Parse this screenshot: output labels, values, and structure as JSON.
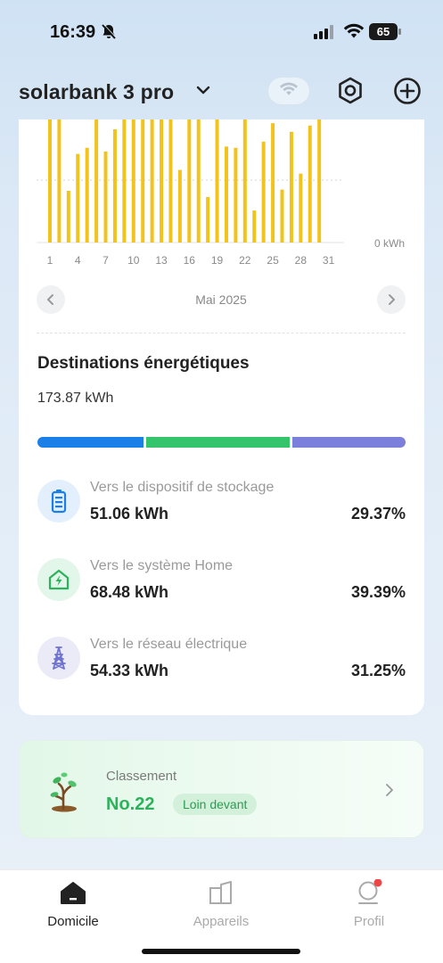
{
  "status": {
    "time": "16:39",
    "battery": "65"
  },
  "header": {
    "device_name": "solarbank 3 pro"
  },
  "chart_data": {
    "type": "bar",
    "x": [
      1,
      2,
      3,
      4,
      5,
      6,
      7,
      8,
      9,
      10,
      11,
      12,
      13,
      14,
      15,
      16,
      17,
      18,
      19,
      20,
      21,
      22,
      23,
      24,
      25,
      26,
      27,
      28,
      29,
      30,
      31
    ],
    "values": [
      10,
      10,
      4.2,
      7.2,
      7.7,
      10,
      7.4,
      9.2,
      10,
      10,
      10,
      10,
      10,
      10,
      5.9,
      10,
      10,
      3.7,
      10,
      7.8,
      7.7,
      10,
      2.6,
      8.2,
      9.7,
      4.3,
      9.0,
      5.6,
      9.5,
      10,
      null
    ],
    "xtick_labels": [
      "1",
      "4",
      "7",
      "10",
      "13",
      "16",
      "19",
      "22",
      "25",
      "28",
      "31"
    ],
    "y_zero_label": "0 kWh",
    "color": "#f2c31c"
  },
  "month_nav": {
    "label": "Mai 2025"
  },
  "destinations": {
    "title": "Destinations énergétiques",
    "total": "173.87 kWh",
    "colors": {
      "storage": "#1a7fe8",
      "home": "#33c46c",
      "grid": "#7b7fdb"
    },
    "items": [
      {
        "label": "Vers le dispositif de stockage",
        "value": "51.06 kWh",
        "percent": "29.37%"
      },
      {
        "label": "Vers le système Home",
        "value": "68.48 kWh",
        "percent": "39.39%"
      },
      {
        "label": "Vers le réseau électrique",
        "value": "54.33 kWh",
        "percent": "31.25%"
      }
    ]
  },
  "ranking": {
    "label": "Classement",
    "value": "No.22",
    "badge": "Loin devant"
  },
  "tabs": [
    {
      "label": "Domicile",
      "active": true
    },
    {
      "label": "Appareils",
      "active": false
    },
    {
      "label": "Profil",
      "active": false
    }
  ]
}
